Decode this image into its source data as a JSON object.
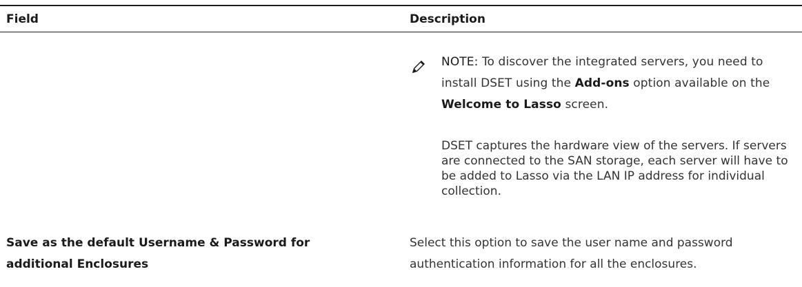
{
  "table": {
    "headers": {
      "field": "Field",
      "description": "Description"
    },
    "note": {
      "label": "NOTE:",
      "text_1": " To discover the integrated servers, you need to install DSET using the ",
      "bold_1": "Add-ons",
      "text_2": " option available on the ",
      "bold_2": "Welcome to Lasso",
      "text_3": " screen.",
      "icon": "pencil-note-icon"
    },
    "note_paragraph": "DSET captures the hardware view of the servers. If servers are connected to the SAN storage, each server will have to be added to Lasso via the LAN IP address for individual collection.",
    "rows": [
      {
        "field": "Save as the default Username & Password for additional Enclosures",
        "description": "Select this option to save the user name and password authentication information for all the enclosures."
      }
    ]
  }
}
